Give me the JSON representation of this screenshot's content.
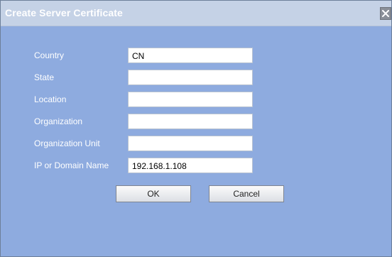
{
  "dialog": {
    "title": "Create Server Certificate",
    "close_icon": "close-icon"
  },
  "form": {
    "fields": [
      {
        "label": "Country",
        "value": "CN"
      },
      {
        "label": "State",
        "value": ""
      },
      {
        "label": "Location",
        "value": ""
      },
      {
        "label": "Organization",
        "value": ""
      },
      {
        "label": "Organization Unit",
        "value": ""
      },
      {
        "label": "IP or Domain Name",
        "value": "192.168.1.108"
      }
    ]
  },
  "buttons": {
    "ok_label": "OK",
    "cancel_label": "Cancel"
  },
  "colors": {
    "dialog_body": "#8eabdf",
    "title_bar": "#c5d2e6",
    "label_text": "#ffffff"
  }
}
